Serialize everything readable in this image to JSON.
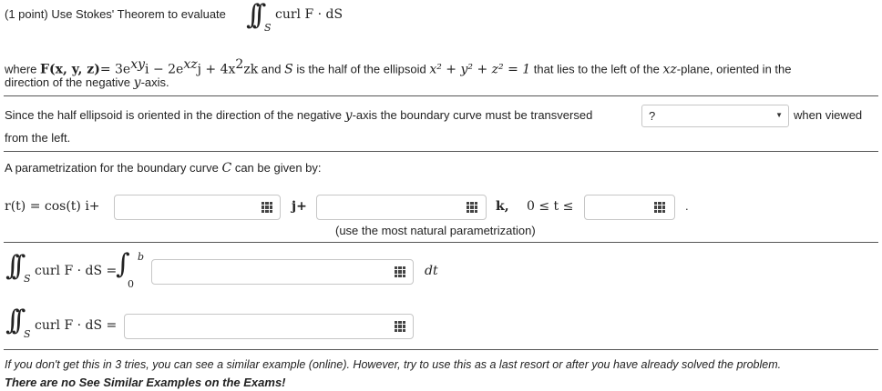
{
  "problem": {
    "points": "(1 point)",
    "intro": "Use Stokes' Theorem to evaluate",
    "integrand": "curl F · dS",
    "integral_sub": "S",
    "where": "where",
    "field_lhs": "F(x, y, z)",
    "field_rhs": "= 3e",
    "field_exp1": "xy",
    "field_i": "i − 2e",
    "field_exp2": "xz",
    "field_j": "j + 4x",
    "field_sq": "2",
    "field_k": "zk",
    "surface_text1": "and",
    "surface_S": "S",
    "surface_text2": "is the half of the ellipsoid",
    "ellipsoid": "x² + y² + z² = 1",
    "surface_text3": "that lies to the left of the",
    "plane": "xz",
    "surface_text4": "-plane, oriented in the",
    "orientation_line2a": "direction of the negative",
    "orientation_axis": "y",
    "orientation_line2b": "-axis."
  },
  "q1": {
    "text_a": "Since the half ellipsoid is oriented in the direction of the negative",
    "axis": "y",
    "text_b": "-axis the boundary curve must be transversed",
    "select_value": "?",
    "text_c": "when viewed",
    "text_d": "from the left."
  },
  "q2": {
    "text_a": "A parametrization for the boundary curve",
    "curve": "C",
    "text_b": "can be given by:",
    "r_lhs": "r(t) = cos(t) i+",
    "j_label": "j+",
    "k_label": "k,",
    "range": "0 ≤ t ≤",
    "period": ".",
    "hint": "(use the most natural parametrization)"
  },
  "q3": {
    "lhs": "curl F · dS =",
    "upper": "b",
    "lower": "0",
    "dt": "dt"
  },
  "q4": {
    "lhs": "curl F · dS ="
  },
  "footer": {
    "note": "If you don't get this in 3 tries, you can see a similar example (online). However, try to use this as a last resort or after you have already solved the problem.",
    "warning": "There are no See Similar Examples on the Exams!"
  },
  "answers": {
    "a1": "",
    "a2": "",
    "a3": "",
    "a4": "",
    "a5": ""
  }
}
